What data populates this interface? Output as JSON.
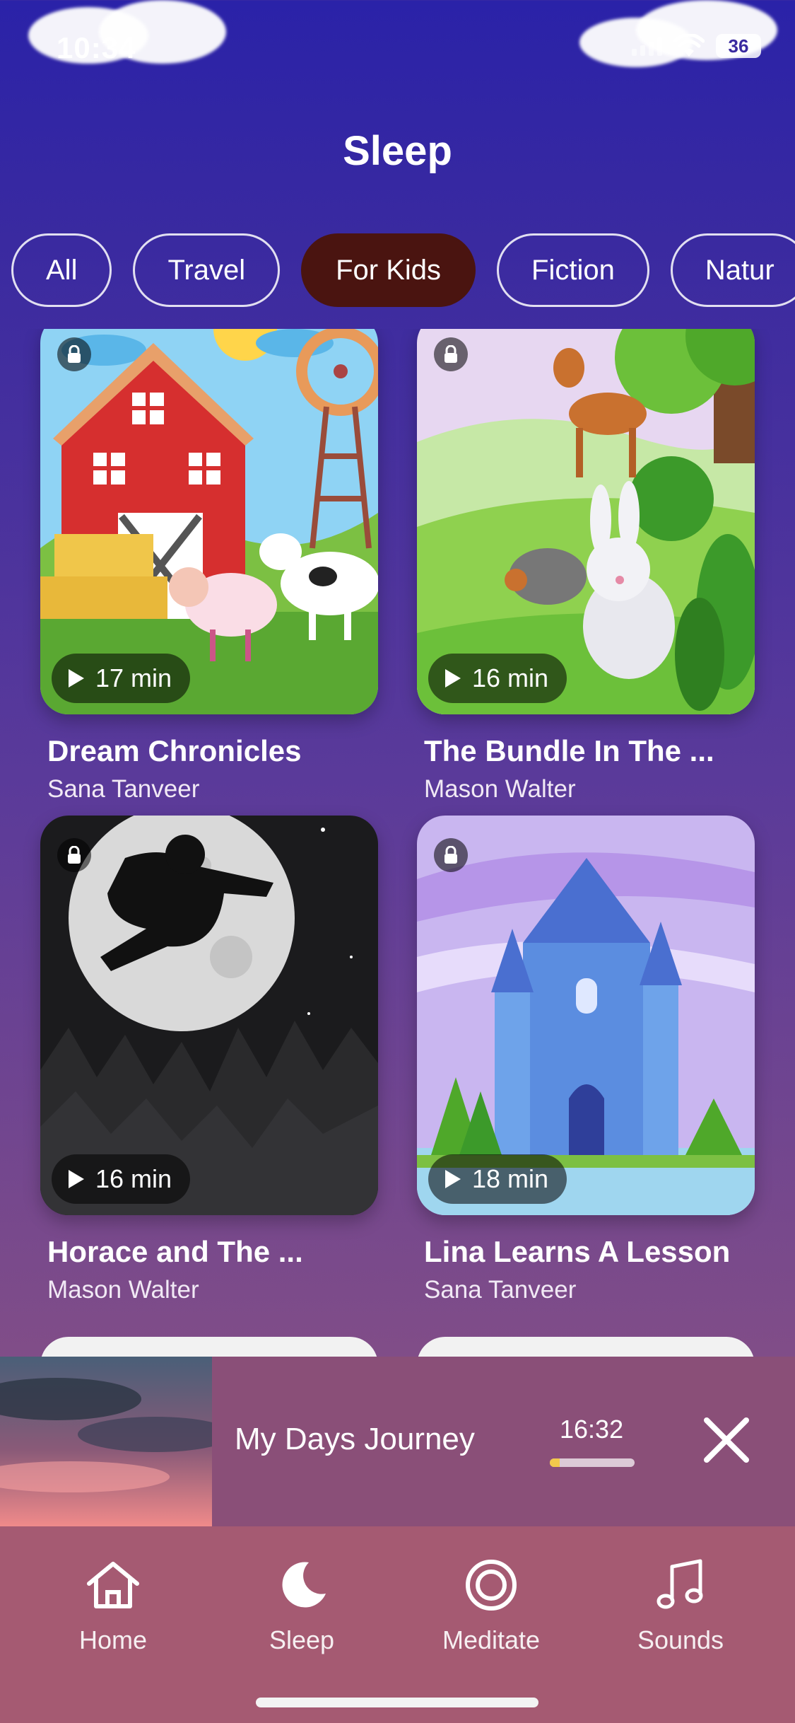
{
  "status": {
    "time": "10:34",
    "battery": "36",
    "icons": [
      "cellular-signal-icon",
      "wifi-icon",
      "battery-icon"
    ]
  },
  "page": {
    "title": "Sleep"
  },
  "filters": [
    {
      "label": "All",
      "selected": false
    },
    {
      "label": "Travel",
      "selected": false
    },
    {
      "label": "For Kids",
      "selected": true
    },
    {
      "label": "Fiction",
      "selected": false
    },
    {
      "label": "Natur",
      "selected": false
    }
  ],
  "cards": [
    {
      "title": "Dream Chronicles",
      "author": "Sana Tanveer",
      "duration": "17 min",
      "locked": true,
      "art": "farm"
    },
    {
      "title": "The Bundle In The ...",
      "author": "Mason Walter",
      "duration": "16 min",
      "locked": true,
      "art": "forest-animals"
    },
    {
      "title": "Horace and The ...",
      "author": "Mason Walter",
      "duration": "16 min",
      "locked": true,
      "art": "moon-hero"
    },
    {
      "title": "Lina Learns A Lesson",
      "author": "Sana Tanveer",
      "duration": "18 min",
      "locked": true,
      "art": "castle"
    }
  ],
  "player": {
    "title": "My Days Journey",
    "time": "16:32",
    "progress": 0.12,
    "accent": "#f2c94c"
  },
  "tabs": [
    {
      "label": "Home",
      "icon": "home-icon",
      "active": false
    },
    {
      "label": "Sleep",
      "icon": "moon-icon",
      "active": true
    },
    {
      "label": "Meditate",
      "icon": "meditate-target-icon",
      "active": false
    },
    {
      "label": "Sounds",
      "icon": "music-note-icon",
      "active": false
    }
  ],
  "colors": {
    "active_chip": "#4a1410",
    "tabbar": "#a55a72",
    "player": "#8a4f78"
  }
}
